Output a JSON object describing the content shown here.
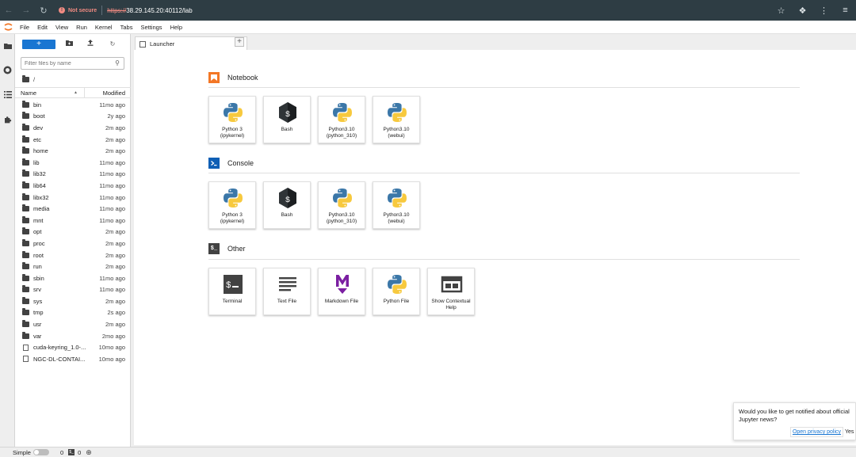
{
  "browser": {
    "security_label": "Not secure",
    "url_scheme": "https://",
    "url_rest": "38.29.145.20:40112/lab"
  },
  "menubar": {
    "items": [
      "File",
      "Edit",
      "View",
      "Run",
      "Kernel",
      "Tabs",
      "Settings",
      "Help"
    ]
  },
  "filebrowser": {
    "search_placeholder": "Filter files by name",
    "breadcrumb": "/",
    "col_name": "Name",
    "col_modified": "Modified",
    "rows": [
      {
        "name": "bin",
        "modified": "11mo ago",
        "type": "folder"
      },
      {
        "name": "boot",
        "modified": "2y ago",
        "type": "folder"
      },
      {
        "name": "dev",
        "modified": "2m ago",
        "type": "folder"
      },
      {
        "name": "etc",
        "modified": "2m ago",
        "type": "folder"
      },
      {
        "name": "home",
        "modified": "2m ago",
        "type": "folder"
      },
      {
        "name": "lib",
        "modified": "11mo ago",
        "type": "folder"
      },
      {
        "name": "lib32",
        "modified": "11mo ago",
        "type": "folder"
      },
      {
        "name": "lib64",
        "modified": "11mo ago",
        "type": "folder"
      },
      {
        "name": "libx32",
        "modified": "11mo ago",
        "type": "folder"
      },
      {
        "name": "media",
        "modified": "11mo ago",
        "type": "folder"
      },
      {
        "name": "mnt",
        "modified": "11mo ago",
        "type": "folder"
      },
      {
        "name": "opt",
        "modified": "2m ago",
        "type": "folder"
      },
      {
        "name": "proc",
        "modified": "2m ago",
        "type": "folder"
      },
      {
        "name": "root",
        "modified": "2m ago",
        "type": "folder"
      },
      {
        "name": "run",
        "modified": "2m ago",
        "type": "folder"
      },
      {
        "name": "sbin",
        "modified": "11mo ago",
        "type": "folder"
      },
      {
        "name": "srv",
        "modified": "11mo ago",
        "type": "folder"
      },
      {
        "name": "sys",
        "modified": "2m ago",
        "type": "folder"
      },
      {
        "name": "tmp",
        "modified": "2s ago",
        "type": "folder"
      },
      {
        "name": "usr",
        "modified": "2m ago",
        "type": "folder"
      },
      {
        "name": "var",
        "modified": "2mo ago",
        "type": "folder"
      },
      {
        "name": "cuda-keyring_1.0-...",
        "modified": "10mo ago",
        "type": "file"
      },
      {
        "name": "NGC-DL-CONTAI...",
        "modified": "10mo ago",
        "type": "file"
      }
    ]
  },
  "tabs": [
    {
      "label": "Launcher"
    }
  ],
  "launcher": {
    "notebook": {
      "title": "Notebook",
      "cards": [
        {
          "line1": "Python 3",
          "line2": "(ipykernel)",
          "icon": "python-icon"
        },
        {
          "line1": "Bash",
          "line2": "",
          "icon": "bash-icon"
        },
        {
          "line1": "Python3.10",
          "line2": "(python_310)",
          "icon": "python-icon"
        },
        {
          "line1": "Python3.10",
          "line2": "(webui)",
          "icon": "python-icon"
        }
      ]
    },
    "console": {
      "title": "Console",
      "cards": [
        {
          "line1": "Python 3",
          "line2": "(ipykernel)",
          "icon": "python-icon"
        },
        {
          "line1": "Bash",
          "line2": "",
          "icon": "bash-icon"
        },
        {
          "line1": "Python3.10",
          "line2": "(python_310)",
          "icon": "python-icon"
        },
        {
          "line1": "Python3.10",
          "line2": "(webui)",
          "icon": "python-icon"
        }
      ]
    },
    "other": {
      "title": "Other",
      "cards": [
        {
          "line1": "Terminal",
          "line2": "",
          "icon": "terminal-icon"
        },
        {
          "line1": "Text File",
          "line2": "",
          "icon": "text-file-icon"
        },
        {
          "line1": "Markdown File",
          "line2": "",
          "icon": "markdown-icon"
        },
        {
          "line1": "Python File",
          "line2": "",
          "icon": "python-icon"
        },
        {
          "line1": "Show Contextual",
          "line2": "Help",
          "icon": "contextual-help-icon"
        }
      ]
    }
  },
  "statusbar": {
    "mode_label": "Simple",
    "kernels_count": "0",
    "terminals_count": "0"
  },
  "toast": {
    "message": "Would you like to get notified about official Jupyter news?",
    "privacy_button": "Open privacy policy",
    "yes_button": "Yes"
  },
  "colors": {
    "accent": "#1976d2",
    "notebook_icon": "#f37726",
    "console_icon": "#0f5fb5",
    "other_icon": "#424242",
    "markdown_icon": "#7b1fa2"
  }
}
